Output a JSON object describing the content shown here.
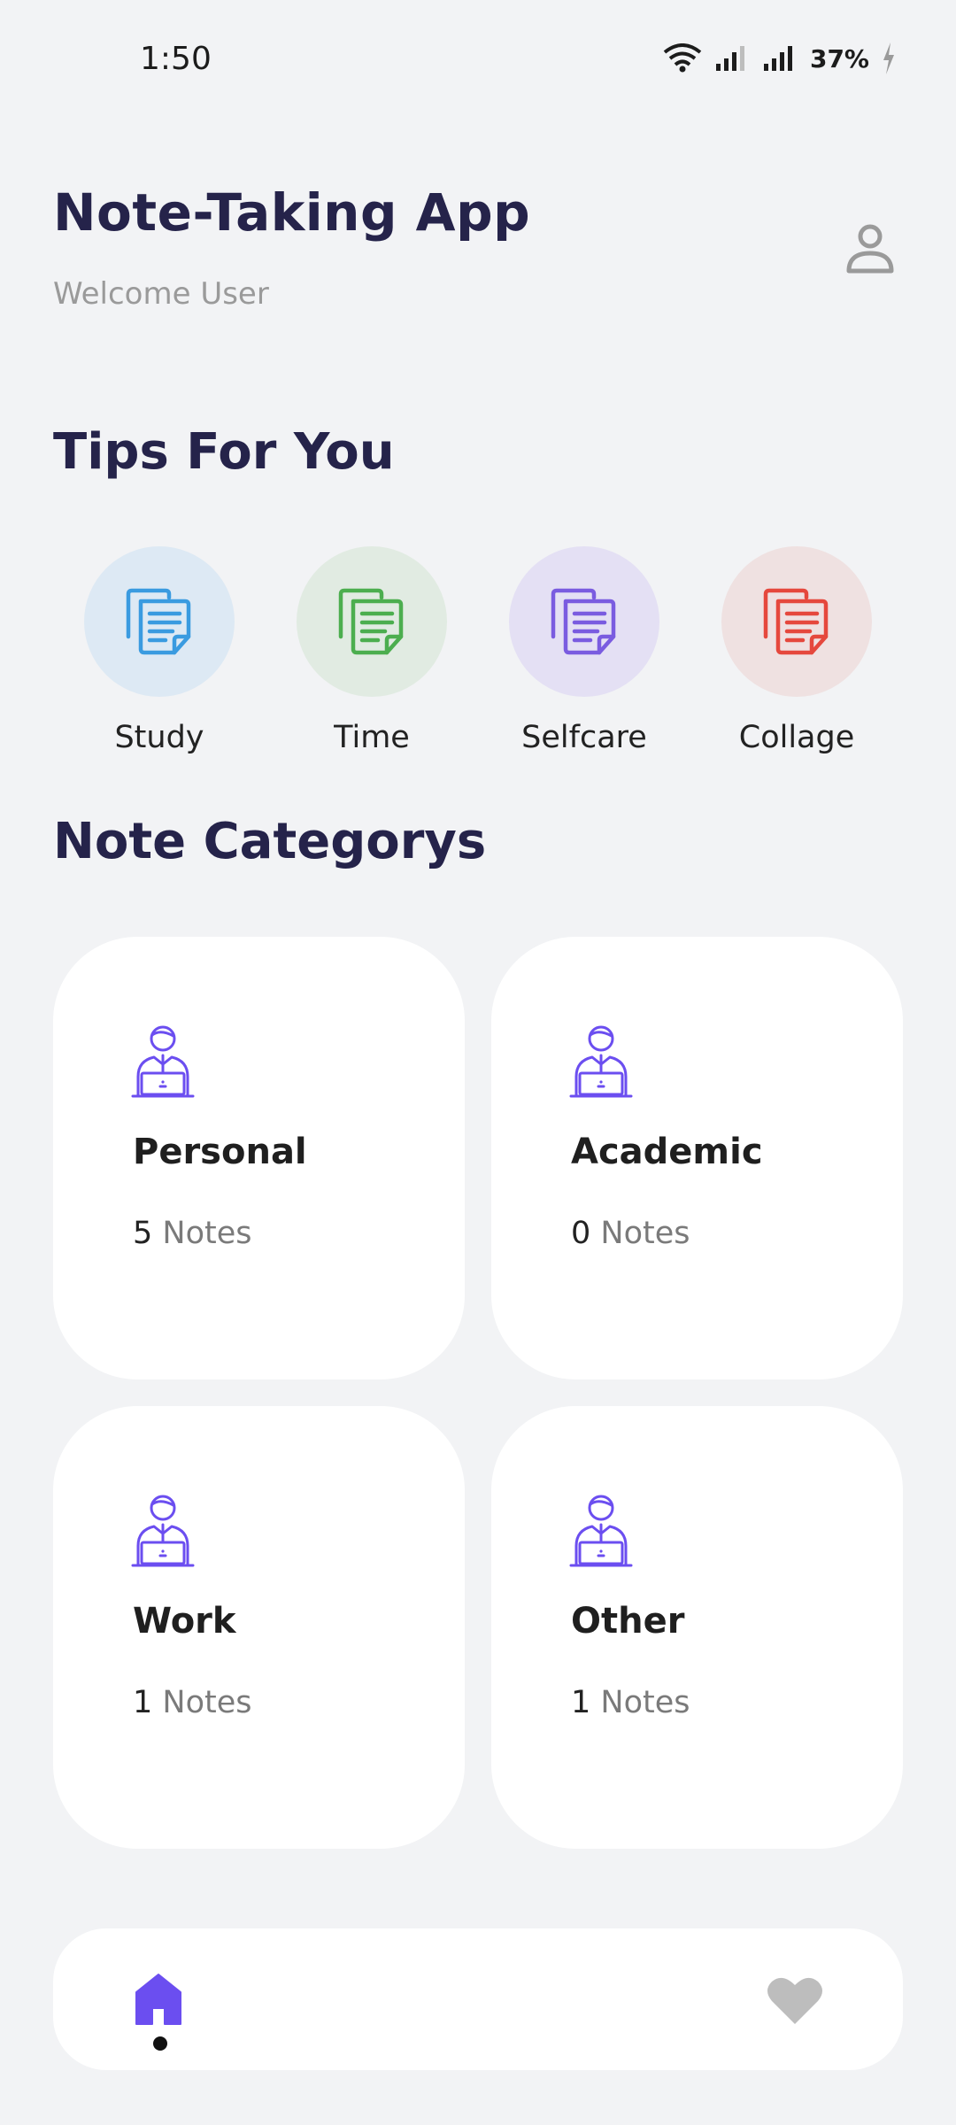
{
  "status_bar": {
    "time": "1:50",
    "battery": "37%",
    "icons": [
      "wifi-icon",
      "signal-icon",
      "signal-icon",
      "battery-charging-icon"
    ]
  },
  "header": {
    "title": "Note-Taking App",
    "subtitle": "Welcome User",
    "profile_icon": "person-icon"
  },
  "tips": {
    "title": "Tips For You",
    "items": [
      {
        "label": "Study",
        "icon": "notes-icon",
        "color": "#3a9be0",
        "bg": "#dde9f4"
      },
      {
        "label": "Time",
        "icon": "notes-icon",
        "color": "#4cae4f",
        "bg": "#e1ebe2"
      },
      {
        "label": "Selfcare",
        "icon": "notes-icon",
        "color": "#7a5ce0",
        "bg": "#e4e0f4"
      },
      {
        "label": "Collage",
        "icon": "notes-icon",
        "color": "#e5483d",
        "bg": "#efe1e1"
      }
    ]
  },
  "categories": {
    "title": "Note Categorys",
    "items": [
      {
        "name": "Personal",
        "count": "5",
        "unit": "Notes",
        "icon": "person-laptop-icon"
      },
      {
        "name": "Academic",
        "count": "0",
        "unit": "Notes",
        "icon": "person-laptop-icon"
      },
      {
        "name": "Work",
        "count": "1",
        "unit": "Notes",
        "icon": "person-laptop-icon"
      },
      {
        "name": "Other",
        "count": "1",
        "unit": "Notes",
        "icon": "person-laptop-icon"
      }
    ]
  },
  "bottom_nav": {
    "items": [
      {
        "icon": "home-icon",
        "active": true,
        "color": "#6b4ef0"
      },
      {
        "icon": "heart-icon",
        "active": false,
        "color": "#bdbdbd"
      }
    ]
  },
  "colors": {
    "accent": "#6b4ef0",
    "title": "#25234a",
    "background": "#f2f3f5"
  }
}
